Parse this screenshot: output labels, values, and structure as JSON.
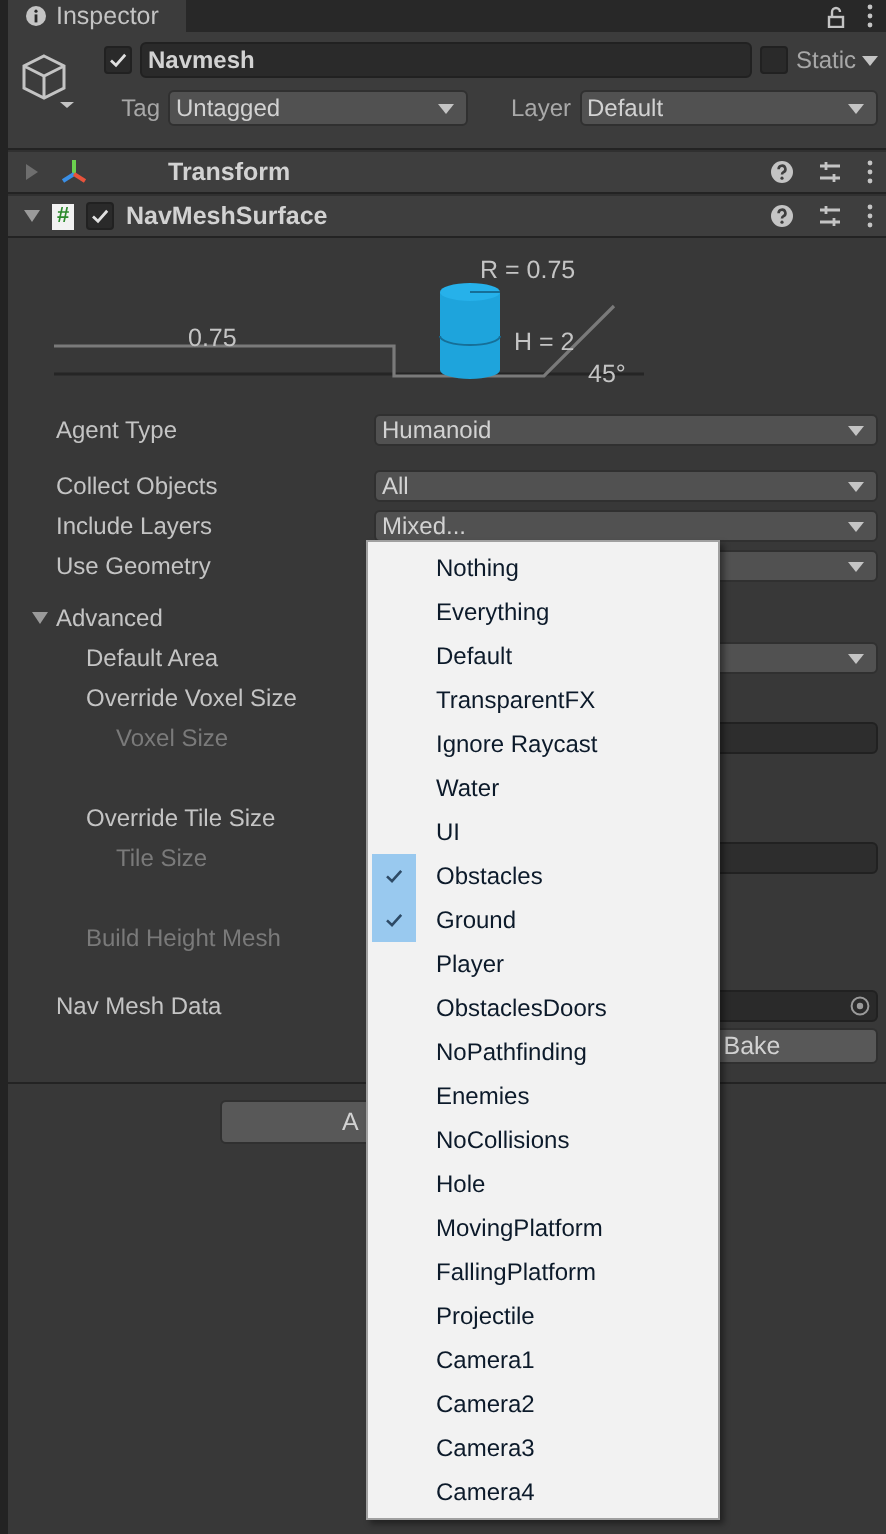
{
  "tab": {
    "label": "Inspector"
  },
  "object": {
    "active": true,
    "name": "Navmesh",
    "static": false,
    "static_label": "Static",
    "tag_label": "Tag",
    "tag": "Untagged",
    "layer_label": "Layer",
    "layer": "Default"
  },
  "components": [
    {
      "title": "Transform",
      "kind": "transform",
      "expanded": false
    },
    {
      "title": "NavMeshSurface",
      "kind": "script",
      "script_glyph": "#",
      "expanded": true,
      "enabled": true
    }
  ],
  "diagram": {
    "radius": "R = 0.75",
    "step": "0.75",
    "height": "H = 2",
    "slope": "45°"
  },
  "properties": [
    {
      "label": "Agent Type",
      "kind": "dropdown",
      "value": "Humanoid"
    },
    {
      "label": "Collect Objects",
      "kind": "dropdown",
      "value": "All"
    },
    {
      "label": "Include Layers",
      "kind": "dropdown",
      "value": "Mixed..."
    },
    {
      "label": "Use Geometry",
      "kind": "dropdown"
    }
  ],
  "advanced": {
    "label": "Advanced",
    "expanded": true,
    "children": [
      {
        "label": "Default Area",
        "kind": "dropdown",
        "disabled": false
      },
      {
        "label": "Override Voxel Size",
        "kind": "label",
        "disabled": false,
        "children": [
          {
            "label": "Voxel Size",
            "kind": "number",
            "disabled": true
          }
        ]
      },
      {
        "label": "Override Tile Size",
        "kind": "label",
        "disabled": false,
        "children": [
          {
            "label": "Tile Size",
            "kind": "number",
            "disabled": true
          }
        ]
      },
      {
        "label": "Build Height Mesh",
        "kind": "label",
        "disabled": true
      }
    ]
  },
  "nav_mesh_data": {
    "label": "Nav Mesh Data"
  },
  "bake_button": "Bake",
  "add_component_button": "A",
  "layer_menu": [
    {
      "label": "Nothing",
      "checked": false
    },
    {
      "label": "Everything",
      "checked": false
    },
    {
      "label": "Default",
      "checked": false
    },
    {
      "label": "TransparentFX",
      "checked": false
    },
    {
      "label": "Ignore Raycast",
      "checked": false
    },
    {
      "label": "Water",
      "checked": false
    },
    {
      "label": "UI",
      "checked": false
    },
    {
      "label": "Obstacles",
      "checked": true
    },
    {
      "label": "Ground",
      "checked": true
    },
    {
      "label": "Player",
      "checked": false
    },
    {
      "label": "ObstaclesDoors",
      "checked": false
    },
    {
      "label": "NoPathfinding",
      "checked": false
    },
    {
      "label": "Enemies",
      "checked": false
    },
    {
      "label": "NoCollisions",
      "checked": false
    },
    {
      "label": "Hole",
      "checked": false
    },
    {
      "label": "MovingPlatform",
      "checked": false
    },
    {
      "label": "FallingPlatform",
      "checked": false
    },
    {
      "label": "Projectile",
      "checked": false
    },
    {
      "label": "Camera1",
      "checked": false
    },
    {
      "label": "Camera2",
      "checked": false
    },
    {
      "label": "Camera3",
      "checked": false
    },
    {
      "label": "Camera4",
      "checked": false
    }
  ]
}
